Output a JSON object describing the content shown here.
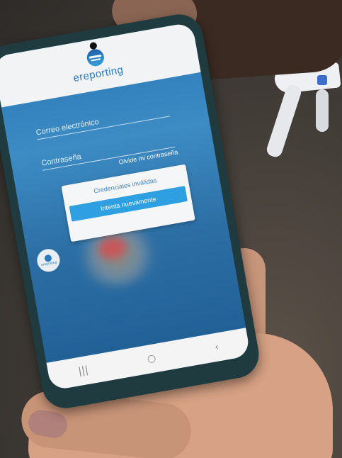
{
  "app": {
    "brand": "ereporting",
    "side_brand": "ereporting"
  },
  "login": {
    "email_label": "Correo electrónico",
    "password_label": "Contraseña",
    "forgot_link": "Olvide mi contraseña"
  },
  "dialog": {
    "message": "Credenciales inválidas",
    "retry_button": "Intenta nuevamente"
  },
  "navbar": {
    "recent_glyph": "|||",
    "home_glyph": "○",
    "back_glyph": "‹"
  }
}
